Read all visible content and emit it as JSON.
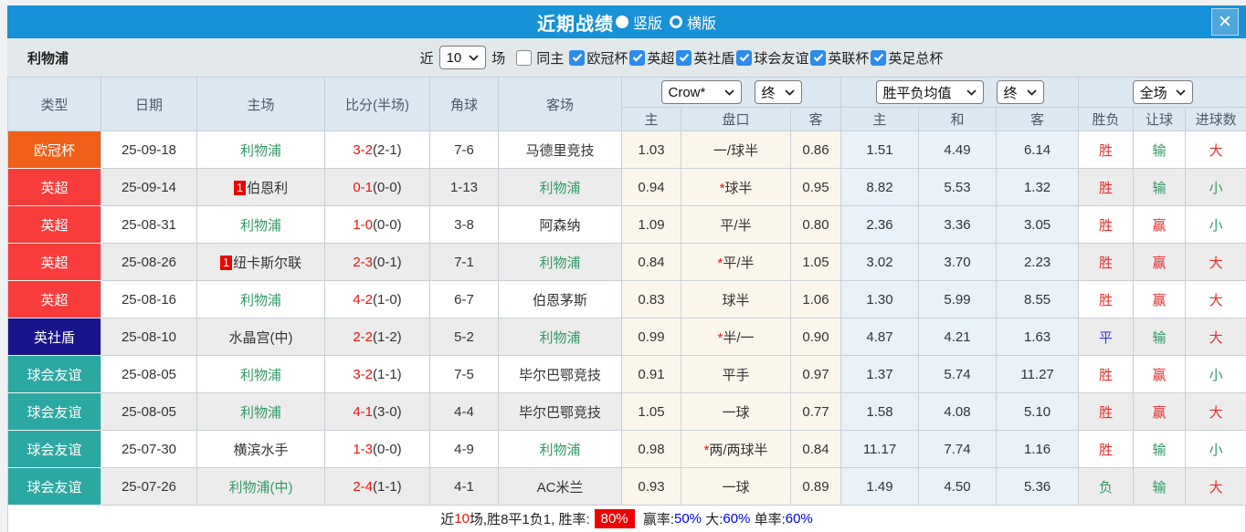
{
  "colors": {
    "titlebar_bg": "#1791d8",
    "red": "#e62e2e",
    "green": "#339966",
    "blue": "#3b3bd6",
    "link_blue": "#0000ee",
    "badge_red": "#ee0000",
    "score_red": "#ee1111"
  },
  "titlebar": {
    "title": "近期战绩",
    "view_options": [
      {
        "label": "竖版",
        "selected": true
      },
      {
        "label": "横版",
        "selected": false
      }
    ]
  },
  "filters": {
    "team": "利物浦",
    "recent_label": "近",
    "recent_value": "10",
    "matches_label": "场",
    "same_home_label": "同主",
    "same_home_checked": false,
    "competitions": [
      {
        "label": "欧冠杯",
        "checked": true
      },
      {
        "label": "英超",
        "checked": true
      },
      {
        "label": "英社盾",
        "checked": true
      },
      {
        "label": "球会友谊",
        "checked": true
      },
      {
        "label": "英联杯",
        "checked": true
      },
      {
        "label": "英足总杯",
        "checked": true
      }
    ]
  },
  "table": {
    "left_headers": [
      "类型",
      "日期",
      "主场",
      "比分(半场)",
      "角球",
      "客场"
    ],
    "selects": {
      "bookmaker": "Crow*",
      "odds_time": "终",
      "avg_type": "胜平负均值",
      "avg_time": "终",
      "scope": "全场"
    },
    "sub_headers": [
      "主",
      "盘口",
      "客",
      "主",
      "和",
      "客",
      "胜负",
      "让球",
      "进球数"
    ],
    "rows": [
      {
        "type": "欧冠杯",
        "type_color": "#f06018",
        "date": "25-09-18",
        "home": {
          "name": "利物浦",
          "green": true,
          "rank": ""
        },
        "score": {
          "full": "3-2",
          "half": "(2-1)"
        },
        "corners": "7-6",
        "away": {
          "name": "马德里竞技",
          "green": false,
          "rank": ""
        },
        "handicap": {
          "home": "1.03",
          "star": false,
          "line": "一/球半",
          "away": "0.86"
        },
        "avg": {
          "home": "1.51",
          "draw": "4.49",
          "away": "6.14"
        },
        "outcome": {
          "text": "胜",
          "color": "red"
        },
        "handicap_outcome": {
          "text": "输",
          "color": "green"
        },
        "goals_outcome": {
          "text": "大",
          "color": "red"
        }
      },
      {
        "type": "英超",
        "type_color": "#f83c3c",
        "date": "25-09-14",
        "home": {
          "name": "伯恩利",
          "green": false,
          "rank": "1"
        },
        "score": {
          "full": "0-1",
          "half": "(0-0)"
        },
        "corners": "1-13",
        "away": {
          "name": "利物浦",
          "green": true,
          "rank": ""
        },
        "handicap": {
          "home": "0.94",
          "star": true,
          "line": "球半",
          "away": "0.95"
        },
        "avg": {
          "home": "8.82",
          "draw": "5.53",
          "away": "1.32"
        },
        "outcome": {
          "text": "胜",
          "color": "red"
        },
        "handicap_outcome": {
          "text": "输",
          "color": "green"
        },
        "goals_outcome": {
          "text": "小",
          "color": "green"
        }
      },
      {
        "type": "英超",
        "type_color": "#f83c3c",
        "date": "25-08-31",
        "home": {
          "name": "利物浦",
          "green": true,
          "rank": ""
        },
        "score": {
          "full": "1-0",
          "half": "(0-0)"
        },
        "corners": "3-8",
        "away": {
          "name": "阿森纳",
          "green": false,
          "rank": ""
        },
        "handicap": {
          "home": "1.09",
          "star": false,
          "line": "平/半",
          "away": "0.80"
        },
        "avg": {
          "home": "2.36",
          "draw": "3.36",
          "away": "3.05"
        },
        "outcome": {
          "text": "胜",
          "color": "red"
        },
        "handicap_outcome": {
          "text": "赢",
          "color": "red"
        },
        "goals_outcome": {
          "text": "小",
          "color": "green"
        }
      },
      {
        "type": "英超",
        "type_color": "#f83c3c",
        "date": "25-08-26",
        "home": {
          "name": "纽卡斯尔联",
          "green": false,
          "rank": "1"
        },
        "score": {
          "full": "2-3",
          "half": "(0-1)"
        },
        "corners": "7-1",
        "away": {
          "name": "利物浦",
          "green": true,
          "rank": ""
        },
        "handicap": {
          "home": "0.84",
          "star": true,
          "line": "平/半",
          "away": "1.05"
        },
        "avg": {
          "home": "3.02",
          "draw": "3.70",
          "away": "2.23"
        },
        "outcome": {
          "text": "胜",
          "color": "red"
        },
        "handicap_outcome": {
          "text": "赢",
          "color": "red"
        },
        "goals_outcome": {
          "text": "大",
          "color": "red"
        }
      },
      {
        "type": "英超",
        "type_color": "#f83c3c",
        "date": "25-08-16",
        "home": {
          "name": "利物浦",
          "green": true,
          "rank": ""
        },
        "score": {
          "full": "4-2",
          "half": "(1-0)"
        },
        "corners": "6-7",
        "away": {
          "name": "伯恩茅斯",
          "green": false,
          "rank": ""
        },
        "handicap": {
          "home": "0.83",
          "star": false,
          "line": "球半",
          "away": "1.06"
        },
        "avg": {
          "home": "1.30",
          "draw": "5.99",
          "away": "8.55"
        },
        "outcome": {
          "text": "胜",
          "color": "red"
        },
        "handicap_outcome": {
          "text": "赢",
          "color": "red"
        },
        "goals_outcome": {
          "text": "大",
          "color": "red"
        }
      },
      {
        "type": "英社盾",
        "type_color": "#18148c",
        "date": "25-08-10",
        "home": {
          "name": "水晶宫(中)",
          "green": false,
          "rank": ""
        },
        "score": {
          "full": "2-2",
          "half": "(1-2)"
        },
        "corners": "5-2",
        "away": {
          "name": "利物浦",
          "green": true,
          "rank": ""
        },
        "handicap": {
          "home": "0.99",
          "star": true,
          "line": "半/一",
          "away": "0.90"
        },
        "avg": {
          "home": "4.87",
          "draw": "4.21",
          "away": "1.63"
        },
        "outcome": {
          "text": "平",
          "color": "blue"
        },
        "handicap_outcome": {
          "text": "输",
          "color": "green"
        },
        "goals_outcome": {
          "text": "大",
          "color": "red"
        }
      },
      {
        "type": "球会友谊",
        "type_color": "#2ca8a2",
        "date": "25-08-05",
        "home": {
          "name": "利物浦",
          "green": true,
          "rank": ""
        },
        "score": {
          "full": "3-2",
          "half": "(1-1)"
        },
        "corners": "7-5",
        "away": {
          "name": "毕尔巴鄂竞技",
          "green": false,
          "rank": ""
        },
        "handicap": {
          "home": "0.91",
          "star": false,
          "line": "平手",
          "away": "0.97"
        },
        "avg": {
          "home": "1.37",
          "draw": "5.74",
          "away": "11.27"
        },
        "outcome": {
          "text": "胜",
          "color": "red"
        },
        "handicap_outcome": {
          "text": "赢",
          "color": "red"
        },
        "goals_outcome": {
          "text": "小",
          "color": "green"
        }
      },
      {
        "type": "球会友谊",
        "type_color": "#2ca8a2",
        "date": "25-08-05",
        "home": {
          "name": "利物浦",
          "green": true,
          "rank": ""
        },
        "score": {
          "full": "4-1",
          "half": "(3-0)"
        },
        "corners": "4-4",
        "away": {
          "name": "毕尔巴鄂竞技",
          "green": false,
          "rank": ""
        },
        "handicap": {
          "home": "1.05",
          "star": false,
          "line": "一球",
          "away": "0.77"
        },
        "avg": {
          "home": "1.58",
          "draw": "4.08",
          "away": "5.10"
        },
        "outcome": {
          "text": "胜",
          "color": "red"
        },
        "handicap_outcome": {
          "text": "赢",
          "color": "red"
        },
        "goals_outcome": {
          "text": "大",
          "color": "red"
        }
      },
      {
        "type": "球会友谊",
        "type_color": "#2ca8a2",
        "date": "25-07-30",
        "home": {
          "name": "横滨水手",
          "green": false,
          "rank": ""
        },
        "score": {
          "full": "1-3",
          "half": "(0-0)"
        },
        "corners": "4-9",
        "away": {
          "name": "利物浦",
          "green": true,
          "rank": ""
        },
        "handicap": {
          "home": "0.98",
          "star": true,
          "line": "两/两球半",
          "away": "0.84"
        },
        "avg": {
          "home": "11.17",
          "draw": "7.74",
          "away": "1.16"
        },
        "outcome": {
          "text": "胜",
          "color": "red"
        },
        "handicap_outcome": {
          "text": "输",
          "color": "green"
        },
        "goals_outcome": {
          "text": "小",
          "color": "green"
        }
      },
      {
        "type": "球会友谊",
        "type_color": "#2ca8a2",
        "date": "25-07-26",
        "home": {
          "name": "利物浦(中)",
          "green": true,
          "rank": ""
        },
        "score": {
          "full": "2-4",
          "half": "(1-1)"
        },
        "corners": "4-1",
        "away": {
          "name": "AC米兰",
          "green": false,
          "rank": ""
        },
        "handicap": {
          "home": "0.93",
          "star": false,
          "line": "一球",
          "away": "0.89"
        },
        "avg": {
          "home": "1.49",
          "draw": "4.50",
          "away": "5.36"
        },
        "outcome": {
          "text": "负",
          "color": "green"
        },
        "handicap_outcome": {
          "text": "输",
          "color": "green"
        },
        "goals_outcome": {
          "text": "大",
          "color": "red"
        }
      }
    ]
  },
  "footer": {
    "segments": [
      {
        "text": "近",
        "style": ""
      },
      {
        "text": "10",
        "style": "red"
      },
      {
        "text": "场,胜8平1负1, 胜率:",
        "style": ""
      },
      {
        "text": "80%",
        "style": "badge"
      },
      {
        "text": " 赢率:",
        "style": ""
      },
      {
        "text": "50%",
        "style": "blue"
      },
      {
        "text": " 大:",
        "style": ""
      },
      {
        "text": "60%",
        "style": "blue"
      },
      {
        "text": " 单率:",
        "style": ""
      },
      {
        "text": "60%",
        "style": "blue"
      }
    ]
  }
}
